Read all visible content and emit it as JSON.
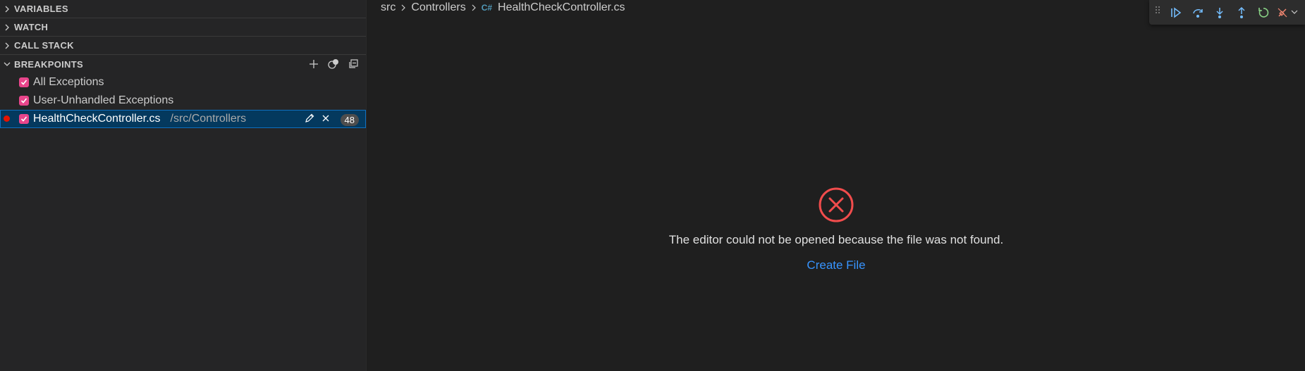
{
  "sidebar": {
    "sections": [
      {
        "title": "VARIABLES"
      },
      {
        "title": "WATCH"
      },
      {
        "title": "CALL STACK"
      }
    ],
    "breakpoints": {
      "title": "BREAKPOINTS",
      "actions": [
        "add-icon",
        "toggle-breakpoints-icon",
        "collapse-all-icon"
      ],
      "items": [
        {
          "label": "All Exceptions",
          "checked": true
        },
        {
          "label": "User-Unhandled Exceptions",
          "checked": true
        },
        {
          "label": "HealthCheckController.cs",
          "path": "/src/Controllers",
          "line": "48",
          "checked": true,
          "selected": true
        }
      ]
    }
  },
  "editor": {
    "breadcrumb": [
      "src",
      "Controllers",
      "HealthCheckController.cs"
    ],
    "file_icon": "C#",
    "error": {
      "message": "The editor could not be opened because the file was not found.",
      "action": "Create File"
    }
  },
  "debug_toolbar": {
    "buttons": [
      "continue-icon",
      "step-over-icon",
      "step-into-icon",
      "step-out-icon",
      "restart-icon",
      "disconnect-icon"
    ]
  },
  "colors": {
    "accent_link": "#3794ff",
    "error_red": "#f14c4c",
    "checkbox": "#e8458b",
    "selection": "#04395e"
  }
}
